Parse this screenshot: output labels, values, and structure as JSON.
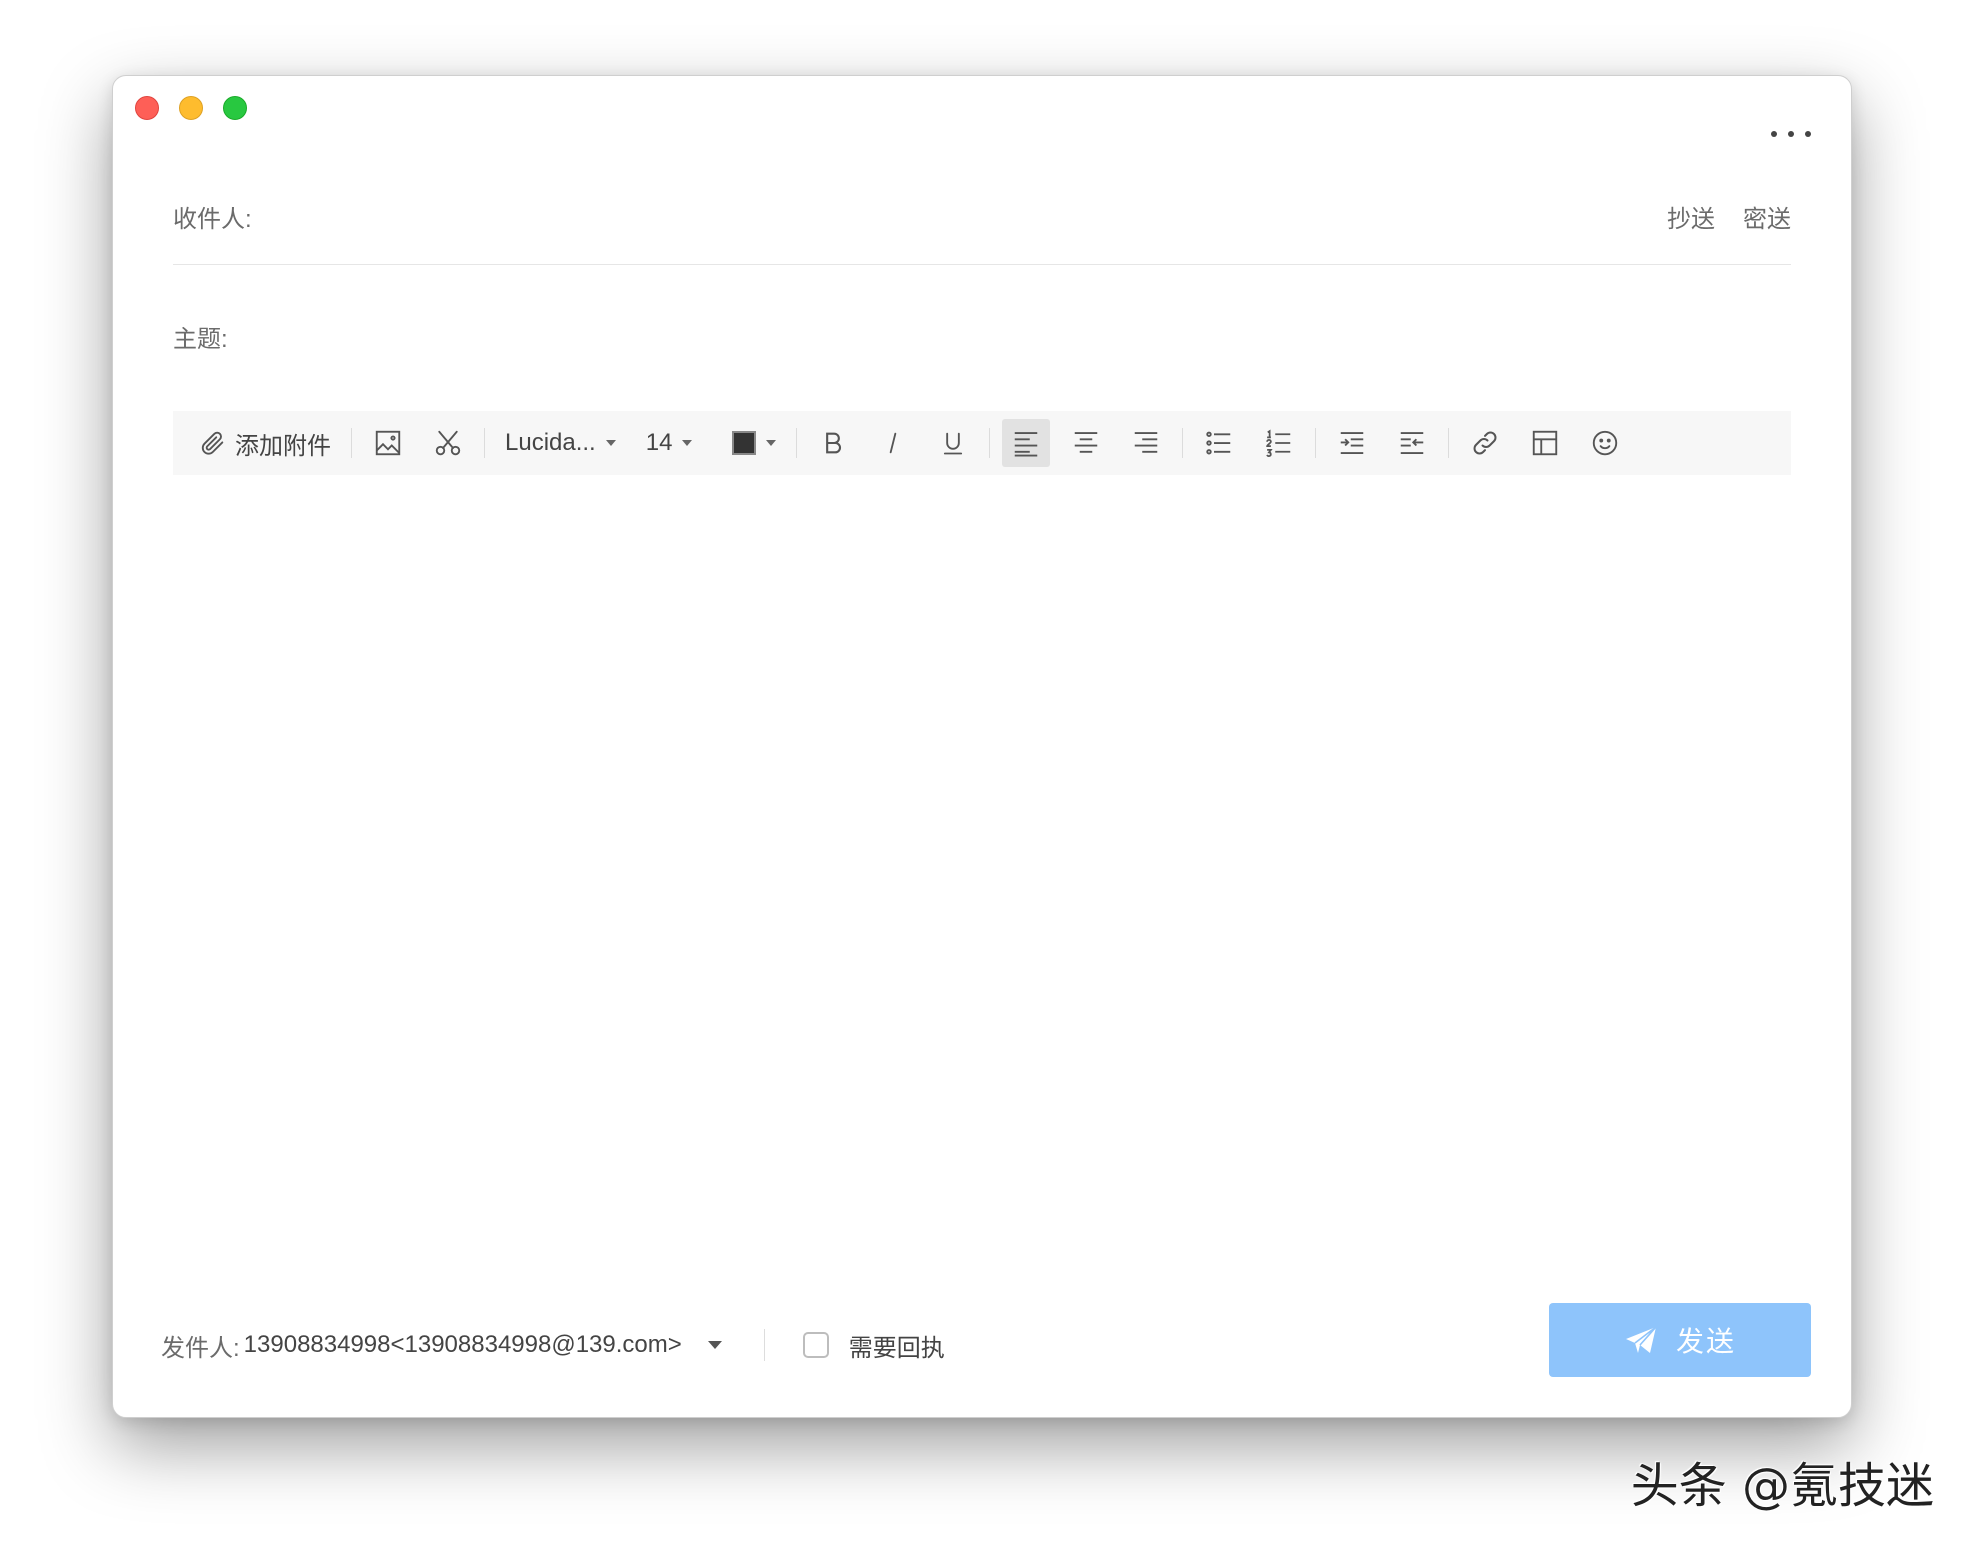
{
  "window": {
    "traffic_lights": [
      "close",
      "minimize",
      "maximize"
    ]
  },
  "header": {
    "more_icon": "more-horizontal-icon"
  },
  "compose": {
    "to_label": "收件人:",
    "cc_label": "抄送",
    "bcc_label": "密送",
    "subject_label": "主题:"
  },
  "toolbar": {
    "attach_label": "添加附件",
    "font_family": "Lucida...",
    "font_size": "14",
    "icons": [
      "paperclip-icon",
      "image-icon",
      "scissors-icon",
      "text-color-icon",
      "bold-icon",
      "italic-icon",
      "underline-icon",
      "align-left-icon",
      "align-center-icon",
      "align-right-icon",
      "bullet-list-icon",
      "numbered-list-icon",
      "indent-icon",
      "outdent-icon",
      "link-icon",
      "table-icon",
      "emoji-icon"
    ],
    "active_alignment": "left"
  },
  "footer": {
    "sender_label": "发件人:",
    "sender_value": "13908834998<13908834998@139.com>",
    "receipt_label": "需要回执",
    "receipt_checked": false
  },
  "send": {
    "label": "发送",
    "color": "#8ec4fb"
  },
  "watermark": {
    "text": "头条 @氪技迷"
  }
}
